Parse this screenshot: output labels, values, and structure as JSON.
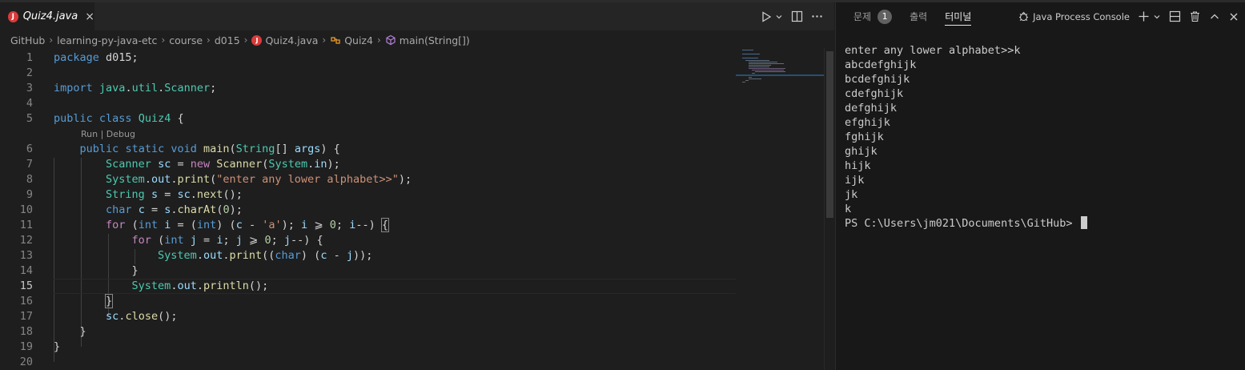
{
  "editor": {
    "tab": {
      "title": "Quiz4.java",
      "icon": "java-file-icon",
      "icon_letter": "J",
      "close": "×"
    },
    "actions": [
      "run-icon",
      "chevron-down-icon",
      "split-editor-icon",
      "more-icon"
    ],
    "breadcrumb": [
      {
        "label": "GitHub",
        "icon": ""
      },
      {
        "label": "learning-py-java-etc",
        "icon": ""
      },
      {
        "label": "course",
        "icon": ""
      },
      {
        "label": "d015",
        "icon": ""
      },
      {
        "label": "Quiz4.java",
        "icon": "java-file-icon"
      },
      {
        "label": "Quiz4",
        "icon": "class-icon"
      },
      {
        "label": "main(String[])",
        "icon": "method-icon"
      }
    ],
    "codelens": "Run | Debug",
    "active_line": 15,
    "line_numbers": [
      "1",
      "2",
      "3",
      "4",
      "5",
      "6",
      "7",
      "8",
      "9",
      "10",
      "11",
      "12",
      "13",
      "14",
      "15",
      "16",
      "17",
      "18",
      "19",
      "20"
    ]
  },
  "panel": {
    "tabs": [
      {
        "label": "문제",
        "badge": "1"
      },
      {
        "label": "출력",
        "badge": ""
      },
      {
        "label": "터미널",
        "badge": ""
      }
    ],
    "active_tab": "터미널",
    "terminal_profile": "Java Process Console",
    "actions": [
      "add-icon",
      "chevron-down-icon",
      "split-terminal-icon",
      "trash-icon",
      "chevron-up-icon",
      "close-icon"
    ],
    "terminal_lines": [
      "enter any lower alphabet>>k",
      "abcdefghijk",
      "bcdefghijk",
      "cdefghijk",
      "defghijk",
      "efghijk",
      "fghijk",
      "ghijk",
      "hijk",
      "ijk",
      "jk",
      "k"
    ],
    "prompt": "PS C:\\Users\\jm021\\Documents\\GitHub> "
  },
  "colors": {
    "keyword": "#569cd6",
    "control": "#c586c0",
    "type": "#4ec9b0",
    "variable": "#9cdcfe",
    "function": "#dcdcaa",
    "string": "#ce9178",
    "number": "#b5cea8",
    "java_badge": "#d93b3b"
  }
}
